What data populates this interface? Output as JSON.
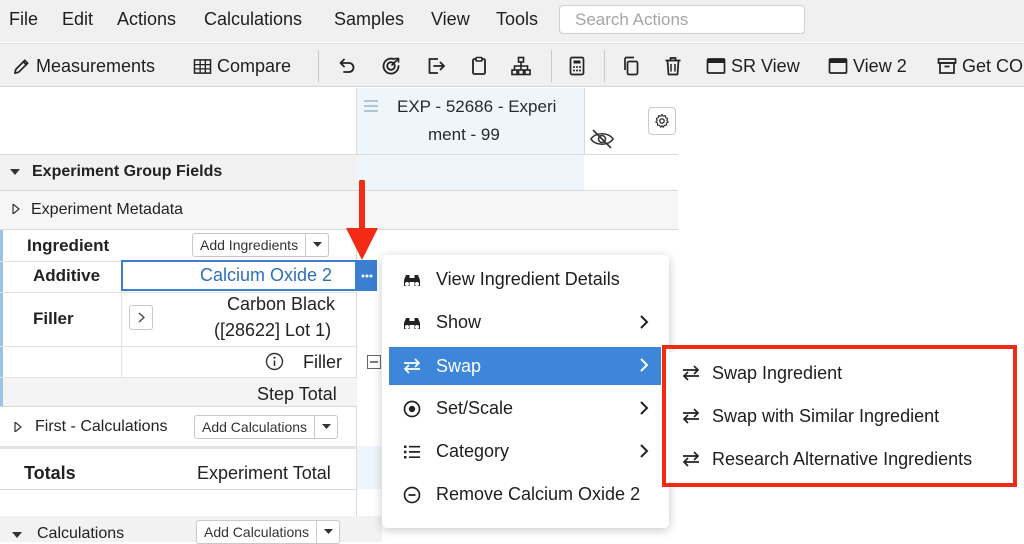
{
  "menubar": {
    "items": [
      "File",
      "Edit",
      "Actions",
      "Calculations",
      "Samples",
      "View",
      "Tools"
    ],
    "search_placeholder": "Search Actions"
  },
  "toolbar": {
    "measurements": "Measurements",
    "compare": "Compare",
    "sr_view": "SR View",
    "view2": "View 2",
    "get_co": "Get CO"
  },
  "column_header": {
    "line1": "EXP - 52686 - Experi",
    "line2": "ment - 99"
  },
  "grid": {
    "experiment_group_fields": "Experiment Group Fields",
    "experiment_metadata": "Experiment Metadata",
    "ingredient_label": "Ingredient",
    "add_ingredients": "Add Ingredients",
    "additive_label": "Additive",
    "additive_value": "Calcium Oxide 2",
    "filler_label": "Filler",
    "filler_value_line1": "Carbon Black",
    "filler_value_line2": "([28622] Lot 1)",
    "filler_type": "Filler",
    "step_total": "Step Total",
    "first_calculations": "First - Calculations",
    "add_calculations": "Add Calculations",
    "totals": "Totals",
    "experiment_total": "Experiment Total",
    "calculations": "Calculations",
    "add_calculations_2": "Add Calculations"
  },
  "context_menu": {
    "items": [
      {
        "label": "View Ingredient Details",
        "icon": "binoculars-icon"
      },
      {
        "label": "Show",
        "icon": "binoculars-icon",
        "submenu": true
      },
      {
        "label": "Swap",
        "icon": "swap-icon",
        "submenu": true,
        "active": true
      },
      {
        "label": "Set/Scale",
        "icon": "target-icon",
        "submenu": true
      },
      {
        "label": "Category",
        "icon": "list-icon",
        "submenu": true
      },
      {
        "label": "Remove Calcium Oxide 2",
        "icon": "minus-circle-icon"
      }
    ]
  },
  "swap_submenu": {
    "items": [
      "Swap Ingredient",
      "Swap with Similar Ingredient",
      "Research Alternative Ingredients"
    ]
  },
  "colors": {
    "accent": "#3d86d9",
    "highlight": "#f42b14"
  }
}
